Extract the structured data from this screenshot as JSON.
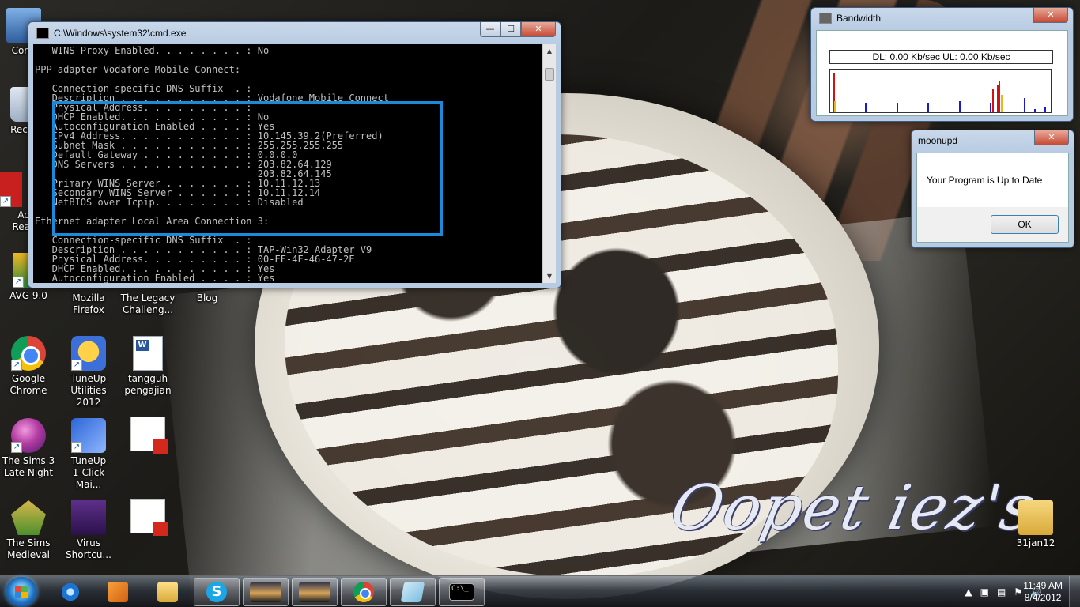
{
  "desktop": {
    "icons": [
      {
        "label": "Com"
      },
      {
        "label": "Recy"
      },
      {
        "label": "Ad\nRea"
      },
      {
        "label": "AVG 9.0"
      },
      {
        "label": "Mozilla\nFirefox"
      },
      {
        "label": "The Legacy\nChalleng..."
      },
      {
        "label": "Blog"
      },
      {
        "label": "Google\nChrome"
      },
      {
        "label": "TuneUp\nUtilities 2012"
      },
      {
        "label": "tangguh\npengajian"
      },
      {
        "label": "The Sims 3\nLate Night"
      },
      {
        "label": "TuneUp\n1-Click Mai..."
      },
      {
        "label": "The Sims\nMedieval"
      },
      {
        "label": "Virus\nShortcu..."
      },
      {
        "label": "31jan12"
      }
    ],
    "watermark": "Oopet iez's"
  },
  "cmd_window": {
    "title": "C:\\Windows\\system32\\cmd.exe",
    "buttons": {
      "minimize": "—",
      "maximize": "☐",
      "close": "✕"
    },
    "lines": [
      "   WINS Proxy Enabled. . . . . . . . : No",
      "",
      "PPP adapter Vodafone Mobile Connect:",
      "",
      "   Connection-specific DNS Suffix  . :",
      "   Description . . . . . . . . . . . : Vodafone Mobile Connect",
      "   Physical Address. . . . . . . . . :",
      "   DHCP Enabled. . . . . . . . . . . : No",
      "   Autoconfiguration Enabled . . . . : Yes",
      "   IPv4 Address. . . . . . . . . . . : 10.145.39.2(Preferred)",
      "   Subnet Mask . . . . . . . . . . . : 255.255.255.255",
      "   Default Gateway . . . . . . . . . : 0.0.0.0",
      "   DNS Servers . . . . . . . . . . . : 203.82.64.129",
      "                                       203.82.64.145",
      "   Primary WINS Server . . . . . . . : 10.11.12.13",
      "   Secondary WINS Server . . . . . . : 10.11.12.14",
      "   NetBIOS over Tcpip. . . . . . . . : Disabled",
      "",
      "Ethernet adapter Local Area Connection 3:",
      "",
      "   Connection-specific DNS Suffix  . :",
      "   Description . . . . . . . . . . . : TAP-Win32 Adapter V9",
      "   Physical Address. . . . . . . . . : 00-FF-4F-46-47-2E",
      "   DHCP Enabled. . . . . . . . . . . : Yes",
      "   Autoconfiguration Enabled . . . . : Yes"
    ]
  },
  "bandwidth": {
    "title": "Bandwidth",
    "close": "✕",
    "readout": "DL: 0.00 Kb/sec  UL: 0.00 Kb/sec",
    "colors": {
      "download": "#1a1acc",
      "upload": "#d41010",
      "peak": "#e8b820"
    }
  },
  "moonupd": {
    "title": "moonupd",
    "close": "✕",
    "message": "Your Program is Up to Date",
    "ok": "OK"
  },
  "taskbar": {
    "pinned": [
      "internet-explorer",
      "windows-media-player",
      "windows-explorer",
      "skype",
      "media-thumbnail",
      "media-thumbnail",
      "google-chrome",
      "sticky-notes",
      "command-prompt"
    ],
    "cmd_label": "C:\\_",
    "skype_label": "S",
    "tray_icons": [
      "▲",
      "▣",
      "▤",
      "⚑",
      "🔊"
    ],
    "clock_time": "11:49 AM",
    "clock_date": "8/4/2012"
  }
}
